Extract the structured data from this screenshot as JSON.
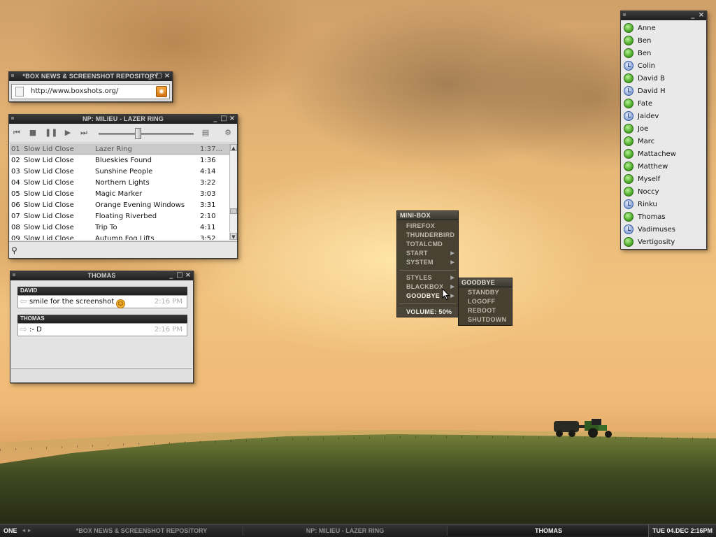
{
  "news_window": {
    "title": "*BOX NEWS & SCREENSHOT REPOSITORY",
    "url": "http://www.boxshots.org/",
    "rss_icon": "rss-icon"
  },
  "player": {
    "title": "NP: MILIEU - LAZER RING",
    "tracks": [
      {
        "num": "01",
        "artist": "Slow Lid Close",
        "title": "Lazer Ring",
        "duration": "1:37..."
      },
      {
        "num": "02",
        "artist": "Slow Lid Close",
        "title": "Blueskies Found",
        "duration": "1:36"
      },
      {
        "num": "03",
        "artist": "Slow Lid Close",
        "title": "Sunshine People",
        "duration": "4:14"
      },
      {
        "num": "04",
        "artist": "Slow Lid Close",
        "title": "Northern Lights",
        "duration": "3:22"
      },
      {
        "num": "05",
        "artist": "Slow Lid Close",
        "title": "Magic Marker",
        "duration": "3:03"
      },
      {
        "num": "06",
        "artist": "Slow Lid Close",
        "title": "Orange Evening Windows",
        "duration": "3:31"
      },
      {
        "num": "07",
        "artist": "Slow Lid Close",
        "title": "Floating Riverbed",
        "duration": "2:10"
      },
      {
        "num": "08",
        "artist": "Slow Lid Close",
        "title": "Trip To",
        "duration": "4:11"
      },
      {
        "num": "09",
        "artist": "Slow Lid Close",
        "title": "Autumn Fog Lifts",
        "duration": "3:52"
      }
    ]
  },
  "chat": {
    "title": "THOMAS",
    "messages": [
      {
        "sender": "DAVID",
        "text": "smile for the screenshot",
        "time": "2:16 PM"
      },
      {
        "sender": "THOMAS",
        "text": ":- D",
        "time": "2:16 PM"
      }
    ]
  },
  "buddies": [
    {
      "name": "Anne",
      "status": "online"
    },
    {
      "name": "Ben",
      "status": "online"
    },
    {
      "name": "Ben",
      "status": "online"
    },
    {
      "name": "Colin",
      "status": "away"
    },
    {
      "name": "David B",
      "status": "online"
    },
    {
      "name": "David H",
      "status": "away"
    },
    {
      "name": "Fate",
      "status": "online"
    },
    {
      "name": "Jaidev",
      "status": "away"
    },
    {
      "name": "Joe",
      "status": "online"
    },
    {
      "name": "Marc",
      "status": "online"
    },
    {
      "name": "Mattachew",
      "status": "online"
    },
    {
      "name": "Matthew",
      "status": "online"
    },
    {
      "name": "Myself",
      "status": "online"
    },
    {
      "name": "Noccy",
      "status": "online"
    },
    {
      "name": "Rinku",
      "status": "away"
    },
    {
      "name": "Thomas",
      "status": "online"
    },
    {
      "name": "Vadimuses",
      "status": "away"
    },
    {
      "name": "Vertigosity",
      "status": "online"
    }
  ],
  "menu": {
    "title": "MINI-BOX",
    "group1": [
      "FIREFOX",
      "THUNDERBIRD",
      "TOTALCMD"
    ],
    "start": "START",
    "system": "SYSTEM",
    "styles": "STYLES",
    "blackbox": "BLACKBOX",
    "goodbye": "GOODBYE",
    "volume": "VOLUME: 50%"
  },
  "submenu": {
    "title": "GOODBYE",
    "items": [
      "STANDBY",
      "LOGOFF",
      "REBOOT",
      "SHUTDOWN"
    ]
  },
  "taskbar": {
    "workspace": "ONE",
    "tasks": [
      "*BOX NEWS & SCREENSHOT REPOSITORY",
      "NP: MILIEU - LAZER RING",
      "THOMAS"
    ],
    "clock": "TUE 04.DEC 2:16PM"
  }
}
